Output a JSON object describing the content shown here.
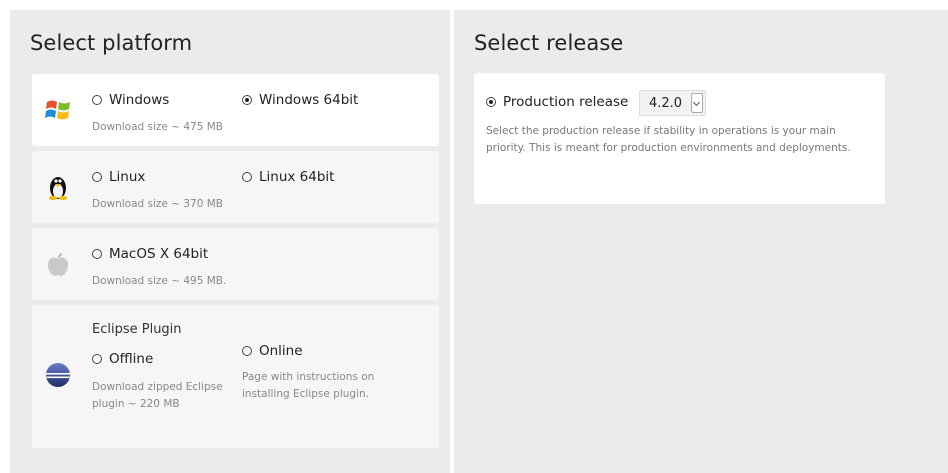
{
  "platform": {
    "title": "Select platform",
    "windows": {
      "option_a": "Windows",
      "option_b": "Windows 64bit",
      "size": "Download size ~ 475 MB",
      "selected": "option_b"
    },
    "linux": {
      "option_a": "Linux",
      "option_b": "Linux 64bit",
      "size": "Download size ~ 370 MB"
    },
    "macos": {
      "option_a": "MacOS X 64bit",
      "size": "Download size ~ 495 MB."
    },
    "eclipse": {
      "heading": "Eclipse Plugin",
      "offline": "Offline",
      "offline_desc": "Download zipped Eclipse plugin ~ 220 MB",
      "online": "Online",
      "online_desc": "Page with instructions on installing Eclipse plugin."
    }
  },
  "release": {
    "title": "Select release",
    "option": "Production release",
    "version": "4.2.0",
    "description": "Select the production release if stability in operations is your main priority. This is meant for production environments and deployments."
  },
  "icons": [
    "windows-icon",
    "linux-icon",
    "apple-icon",
    "eclipse-icon"
  ]
}
